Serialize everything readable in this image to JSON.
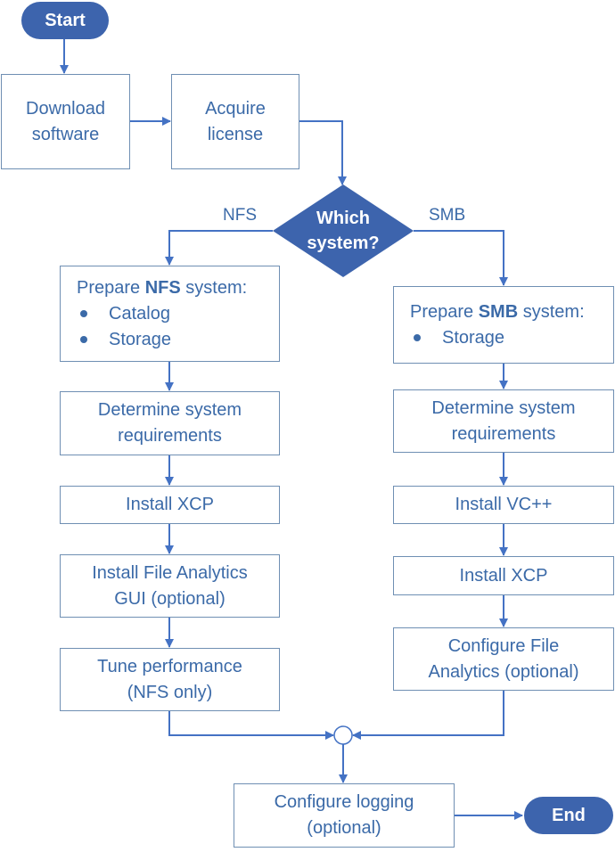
{
  "colors": {
    "accent": "#3d64ad",
    "line": "#4472c4",
    "text": "#3b6aa8",
    "border": "#6f8fb3"
  },
  "start": "Start",
  "end": "End",
  "download": [
    "Download",
    "software"
  ],
  "acquire": [
    "Acquire",
    "license"
  ],
  "decision": [
    "Which",
    "system?"
  ],
  "branch_nfs": "NFS",
  "branch_smb": "SMB",
  "nfs": {
    "prepare": {
      "prefix": "Prepare ",
      "bold": "NFS",
      "suffix": " system:",
      "bullets": [
        "Catalog",
        "Storage"
      ]
    },
    "steps": [
      [
        "Determine system",
        "requirements"
      ],
      [
        "Install XCP"
      ],
      [
        "Install File Analytics",
        "GUI (optional)"
      ],
      [
        "Tune performance",
        "(NFS only)"
      ]
    ]
  },
  "smb": {
    "prepare": {
      "prefix": "Prepare ",
      "bold": "SMB",
      "suffix": " system:",
      "bullets": [
        "Storage"
      ]
    },
    "steps": [
      [
        "Determine system",
        "requirements"
      ],
      [
        "Install VC++"
      ],
      [
        "Install XCP"
      ],
      [
        "Configure File",
        "Analytics (optional)"
      ]
    ]
  },
  "logging": [
    "Configure logging",
    "(optional)"
  ]
}
